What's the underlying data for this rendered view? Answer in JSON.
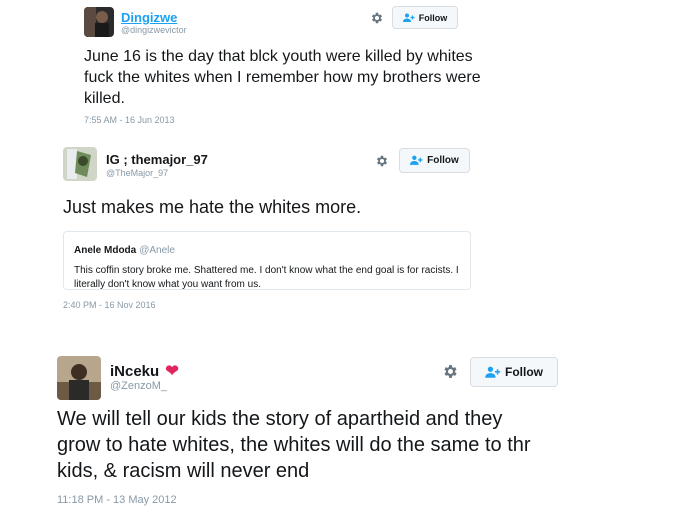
{
  "tweets": [
    {
      "name": "Dingizwe",
      "handle": "@dingizwevictor",
      "text": "June 16 is the day that blck youth were killed by whites fuck the whites when I remember how my brothers were killed.",
      "timestamp": "7:55 AM - 16 Jun 2013",
      "follow_label": "Follow"
    },
    {
      "name": "IG ; themajor_97",
      "handle": "@TheMajor_97",
      "text": "Just makes me hate the whites more.",
      "timestamp": "2:40 PM - 16 Nov 2016",
      "follow_label": "Follow",
      "quote": {
        "name": "Anele Mdoda",
        "handle": "@Anele",
        "text": "This coffin story broke me. Shattered me. I don't know what the end goal is for racists. I literally don't know what you want from us."
      }
    },
    {
      "name": "iNceku",
      "name_emoji": "❤",
      "handle": "@ZenzoM_",
      "text": "We will tell our kids the story of apartheid and they grow to hate whites, the whites will do the same to thr kids, & racism will never end",
      "timestamp": "11:18 PM - 13 May 2012",
      "follow_label": "Follow"
    }
  ],
  "colors": {
    "link_blue": "#1da1f2",
    "heart_red": "#e0245e",
    "muted": "#8899a6"
  },
  "icons": {
    "settings": "gear-icon",
    "follow": "add-user-icon"
  }
}
